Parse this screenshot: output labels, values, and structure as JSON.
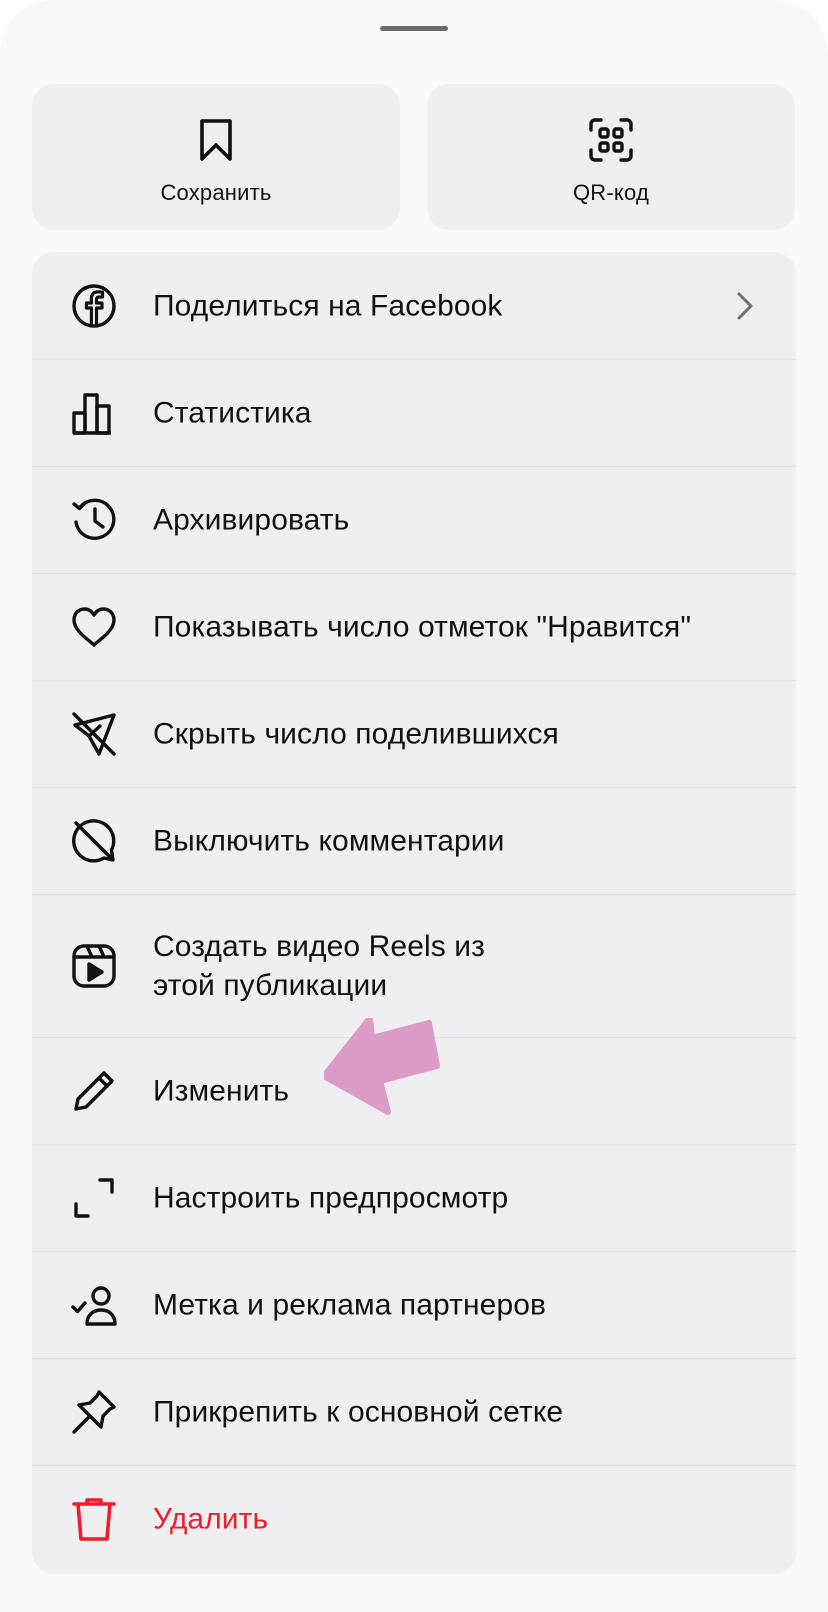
{
  "top_actions": [
    {
      "label": "Сохранить",
      "icon": "bookmark-icon"
    },
    {
      "label": "QR-код",
      "icon": "qr-code-icon"
    }
  ],
  "menu": {
    "items": [
      {
        "label": "Поделиться на Facebook",
        "icon": "facebook-icon",
        "has_chevron": true
      },
      {
        "label": "Статистика",
        "icon": "bar-chart-icon"
      },
      {
        "label": "Архивировать",
        "icon": "archive-history-icon"
      },
      {
        "label": "Показывать число отметок \"Нравится\"",
        "icon": "heart-icon"
      },
      {
        "label": "Скрыть число поделившихся",
        "icon": "share-off-icon"
      },
      {
        "label": "Выключить комментарии",
        "icon": "comments-off-icon"
      },
      {
        "label": "Создать видео Reels из этой публикации",
        "icon": "reels-icon"
      },
      {
        "label": "Изменить",
        "icon": "pencil-icon"
      },
      {
        "label": "Настроить предпросмотр",
        "icon": "crop-corners-icon"
      },
      {
        "label": "Метка и реклама партнеров",
        "icon": "partner-tag-icon"
      },
      {
        "label": "Прикрепить к основной сетке",
        "icon": "pin-icon"
      },
      {
        "label": "Удалить",
        "icon": "trash-icon",
        "danger": true
      }
    ]
  },
  "colors": {
    "danger": "#ee1d2a",
    "annotation_arrow": "#dc9cc7"
  }
}
